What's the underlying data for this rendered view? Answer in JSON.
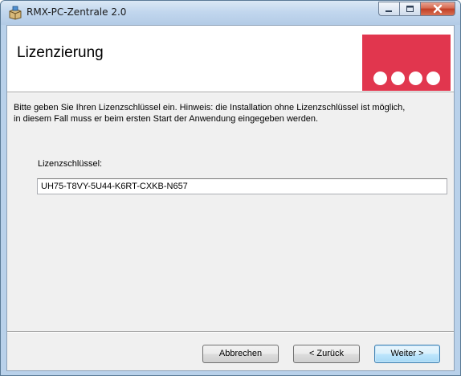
{
  "window": {
    "title": "RMX-PC-Zentrale 2.0",
    "icon": "installer-box-icon",
    "caption_buttons": [
      "minimize-icon",
      "maximize-icon",
      "close-icon"
    ]
  },
  "banner": {
    "title": "Lizenzierung",
    "logo_color": "#e1364e"
  },
  "info_text": "Bitte geben Sie Ihren Lizenzschlüssel ein. Hinweis: die Installation ohne Lizenzschlüssel ist möglich,\nin diesem Fall muss er beim ersten Start der Anwendung eingegeben werden.",
  "license": {
    "label": "Lizenzschlüssel:",
    "value": "UH75-T8VY-5U44-K6RT-CXKB-N657"
  },
  "buttons": {
    "cancel": "Abbrechen",
    "back": "< Zurück",
    "next": "Weiter >"
  }
}
